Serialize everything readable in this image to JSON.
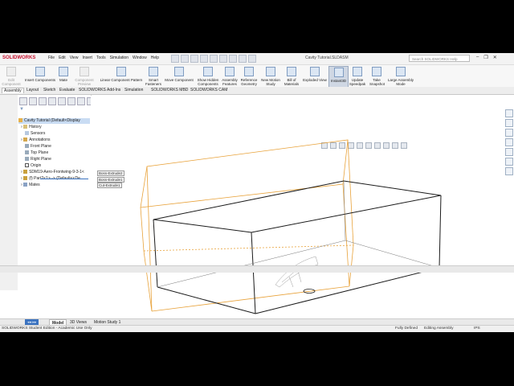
{
  "app": {
    "brand": "SOLIDWORKS",
    "window_title": "Cavity Tutorial.SLDASM",
    "search_placeholder": "Search SOLIDWORKS Help",
    "menu": [
      "File",
      "Edit",
      "View",
      "Insert",
      "Tools",
      "Simulation",
      "Window",
      "Help"
    ],
    "window_buttons": [
      "–",
      "❐",
      "✕"
    ]
  },
  "ribbon": {
    "buttons": [
      {
        "label": "Edit Component",
        "disabled": true
      },
      {
        "label": "Insert Components",
        "disabled": false
      },
      {
        "label": "Mate",
        "disabled": false
      },
      {
        "label": "Component Preview Window",
        "disabled": true
      },
      {
        "label": "Linear Component Pattern",
        "disabled": false
      },
      {
        "label": "Smart Fasteners",
        "disabled": false
      },
      {
        "label": "Move Component",
        "disabled": false
      },
      {
        "label": "Show Hidden Components",
        "disabled": false
      },
      {
        "label": "Assembly Features",
        "disabled": false
      },
      {
        "label": "Reference Geometry",
        "disabled": false
      },
      {
        "label": "New Motion Study",
        "disabled": false
      },
      {
        "label": "Bill of Materials",
        "disabled": false
      },
      {
        "label": "Exploded View",
        "disabled": false
      },
      {
        "label": "Instant3D",
        "disabled": false,
        "active": true
      },
      {
        "label": "Update Speedpak",
        "disabled": false
      },
      {
        "label": "Take Snapshot",
        "disabled": false
      },
      {
        "label": "Large Assembly Mode",
        "disabled": false
      }
    ]
  },
  "command_tabs": [
    "Assembly",
    "Layout",
    "Sketch",
    "Evaluate",
    "SOLIDWORKS Add-Ins",
    "Simulation",
    "SOLIDWORKS MBD",
    "SOLIDWORKS CAM"
  ],
  "feature_tree": {
    "root": "Cavity Tutorial  (Default<Display",
    "items": [
      {
        "label": "History",
        "icon": "folder-icon"
      },
      {
        "label": "Sensors",
        "icon": "sensor-icon"
      },
      {
        "label": "Annotations",
        "icon": "annotation-icon"
      },
      {
        "label": "Front Plane",
        "icon": "plane-icon"
      },
      {
        "label": "Top Plane",
        "icon": "plane-icon"
      },
      {
        "label": "Right Plane",
        "icon": "plane-icon"
      },
      {
        "label": "Origin",
        "icon": "origin-icon"
      },
      {
        "label": "SDM19-Aero-Frontwing-9-3-1<",
        "icon": "part-icon"
      },
      {
        "label": "(f) Part2<1> -> (Default<<De",
        "icon": "part-icon"
      },
      {
        "label": "Mates",
        "icon": "mates-icon"
      }
    ]
  },
  "callouts": [
    "Boss-Extrude2",
    "Boss-Extrude1",
    "Cut-Extrude1"
  ],
  "bottom_tabs": [
    "Model",
    "3D Views",
    "Motion Study 1"
  ],
  "status": {
    "left": "SOLIDWORKS Student Edition - Academic Use Only",
    "defined": "Fully Defined",
    "mode": "Editing Assembly",
    "units": "IPS"
  },
  "colors": {
    "brand_red": "#c8102e",
    "edge_orange": "#e8a23a",
    "edge_dark": "#1b1b1b",
    "selection_blue": "#c9dcf3"
  }
}
